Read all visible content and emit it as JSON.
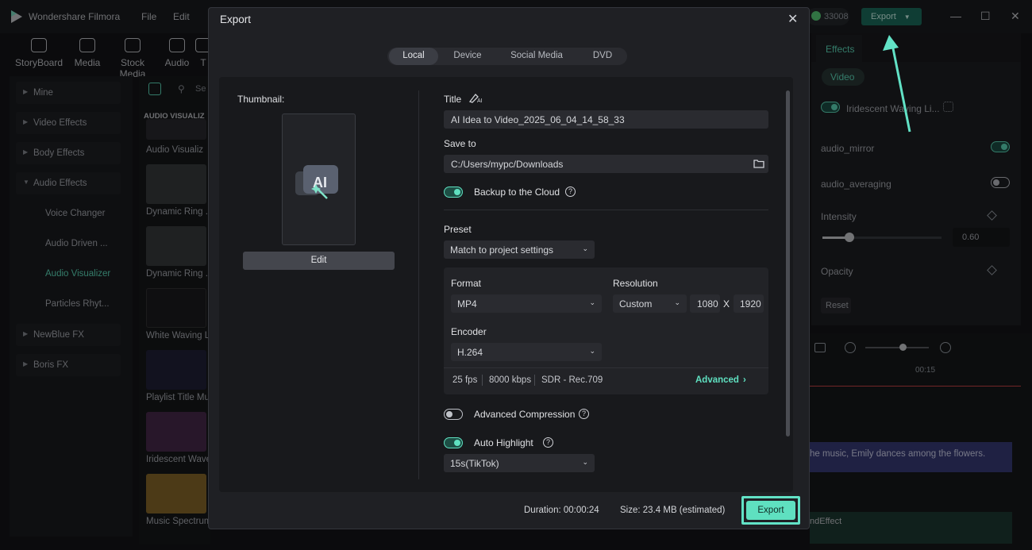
{
  "app": {
    "title": "Wondershare Filmora",
    "menu": [
      "File",
      "Edit"
    ],
    "credits": "33008",
    "export_label": "Export"
  },
  "toolbar": {
    "items": [
      "StoryBoard",
      "Media",
      "Stock Media",
      "Audio",
      "T"
    ]
  },
  "left_panel": {
    "categories": [
      "Mine",
      "Video Effects",
      "Body Effects",
      "Audio Effects"
    ],
    "audio_subs": [
      "Voice Changer",
      "Audio Driven ...",
      "Audio Visualizer",
      "Particles Rhyt..."
    ],
    "more_categories": [
      "NewBlue FX",
      "Boris FX"
    ],
    "search_placeholder": "Se"
  },
  "effects_list": {
    "section": "AUDIO VISUALIZ",
    "items": [
      "Audio Visualiz",
      "Dynamic Ring ...",
      "Dynamic Ring ...",
      "White Waving L",
      "Playlist Title Mu",
      "Iridescent Wave",
      "Music Spectrum"
    ]
  },
  "right_panel": {
    "tab": "Effects",
    "chip": "Video",
    "effect_name": "Iridescent Waving Li...",
    "toggles": [
      {
        "label": "audio_mirror",
        "on": true
      },
      {
        "label": "audio_averaging",
        "on": false
      }
    ],
    "intensity_label": "Intensity",
    "intensity_value": "0.60",
    "opacity_label": "Opacity",
    "reset_label": "Reset"
  },
  "timeline": {
    "time": "00:15",
    "text_clip": "he music, Emily dances among the flowers.",
    "sound_clip": "ndEffect"
  },
  "export_dialog": {
    "title": "Export",
    "tabs": [
      "Local",
      "Device",
      "Social Media",
      "DVD"
    ],
    "active_tab": "Local",
    "thumbnail_label": "Thumbnail:",
    "edit_label": "Edit",
    "title_label": "Title",
    "title_value": "AI Idea to Video_2025_06_04_14_58_33",
    "save_to_label": "Save to",
    "save_to_value": "C:/Users/mypc/Downloads",
    "backup_label": "Backup to the Cloud",
    "backup_on": true,
    "preset_label": "Preset",
    "preset_value": "Match to project settings",
    "format_label": "Format",
    "format_value": "MP4",
    "resolution_label": "Resolution",
    "resolution_value": "Custom",
    "width": "1080",
    "x_label": "X",
    "height": "1920",
    "encoder_label": "Encoder",
    "encoder_value": "H.264",
    "fps": "25 fps",
    "bitrate": "8000 kbps",
    "color": "SDR - Rec.709",
    "advanced_label": "Advanced",
    "adv_compression_label": "Advanced Compression",
    "adv_compression_on": false,
    "auto_highlight_label": "Auto Highlight",
    "auto_highlight_on": true,
    "highlight_value": "15s(TikTok)",
    "duration_label": "Duration:",
    "duration_value": "00:00:24",
    "size_label": "Size:",
    "size_value": "23.4 MB (estimated)",
    "export_label": "Export"
  },
  "colors": {
    "accent": "#5fe0c0",
    "background": "#141518",
    "dialog": "#1f2024",
    "panel": "#18191c"
  },
  "icons": [
    "app-logo-icon",
    "folder-icon",
    "help-icon",
    "close-icon",
    "chevron-down-icon",
    "ai-edit-icon",
    "diamond-icon"
  ]
}
